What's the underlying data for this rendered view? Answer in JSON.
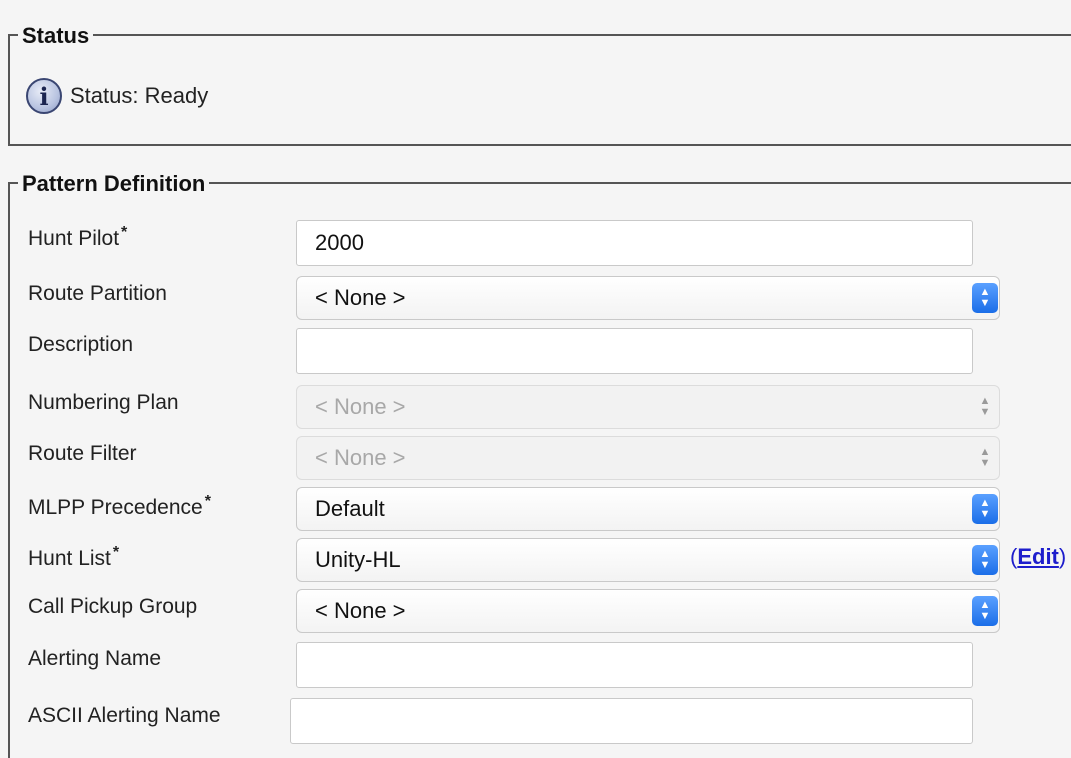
{
  "status_section": {
    "legend": "Status",
    "message": "Status: Ready"
  },
  "pattern_section": {
    "legend": "Pattern Definition",
    "fields": {
      "hunt_pilot": {
        "label": "Hunt Pilot",
        "required": "*",
        "value": "2000"
      },
      "route_partition": {
        "label": "Route Partition",
        "value": "< None >"
      },
      "description": {
        "label": "Description",
        "value": ""
      },
      "numbering_plan": {
        "label": "Numbering Plan",
        "value": "< None >"
      },
      "route_filter": {
        "label": "Route Filter",
        "value": "< None >"
      },
      "mlpp_precedence": {
        "label": "MLPP Precedence",
        "required": "*",
        "value": "Default"
      },
      "hunt_list": {
        "label": "Hunt List",
        "required": "*",
        "value": "Unity-HL",
        "link_open": "(",
        "link_label": "Edit",
        "link_close": ")"
      },
      "call_pickup_group": {
        "label": "Call Pickup Group",
        "value": "< None >"
      },
      "alerting_name": {
        "label": "Alerting Name",
        "value": ""
      },
      "ascii_alerting_name": {
        "label": "ASCII Alerting Name",
        "value": ""
      }
    }
  },
  "icons": {
    "info": "info-icon",
    "select_arrows": "updown-chevron-icon"
  },
  "colors": {
    "select_accent": "#1b6ee8",
    "link": "#1d1dcc",
    "border": "#555555"
  }
}
